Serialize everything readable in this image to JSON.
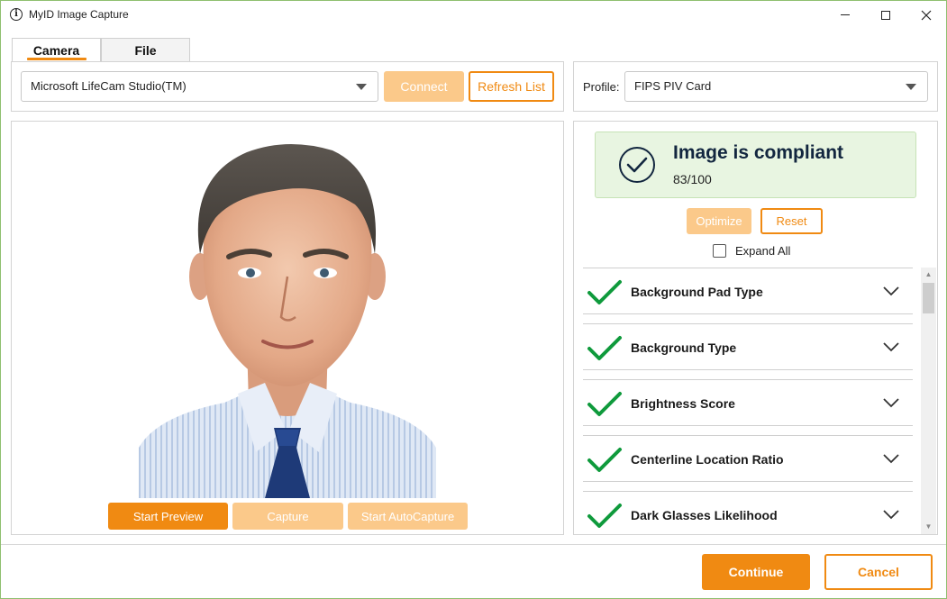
{
  "window": {
    "title": "MyID Image Capture",
    "icon": "info-icon"
  },
  "tabs": [
    {
      "label": "Camera",
      "active": true
    },
    {
      "label": "File",
      "active": false
    }
  ],
  "camera": {
    "selected": "Microsoft LifeCam Studio(TM)",
    "connect_label": "Connect",
    "refresh_label": "Refresh List"
  },
  "profile": {
    "label": "Profile:",
    "selected": "FIPS PIV Card"
  },
  "preview": {
    "start_preview_label": "Start Preview",
    "capture_label": "Capture",
    "start_autocapture_label": "Start AutoCapture"
  },
  "compliance": {
    "title": "Image is compliant",
    "score": "83/100",
    "optimize_label": "Optimize",
    "reset_label": "Reset",
    "expand_all_label": "Expand All",
    "expand_all_checked": false,
    "items": [
      {
        "label": "Background Pad Type",
        "status": "pass"
      },
      {
        "label": "Background Type",
        "status": "pass"
      },
      {
        "label": "Brightness Score",
        "status": "pass"
      },
      {
        "label": "Centerline Location Ratio",
        "status": "pass"
      },
      {
        "label": "Dark Glasses Likelihood",
        "status": "pass"
      }
    ]
  },
  "footer": {
    "continue_label": "Continue",
    "cancel_label": "Cancel"
  },
  "colors": {
    "accent": "#f08a12",
    "accent_disabled": "#fbc98a",
    "success": "#0f9a3c",
    "compliant_bg": "#e8f5e1",
    "heading": "#12263f"
  }
}
